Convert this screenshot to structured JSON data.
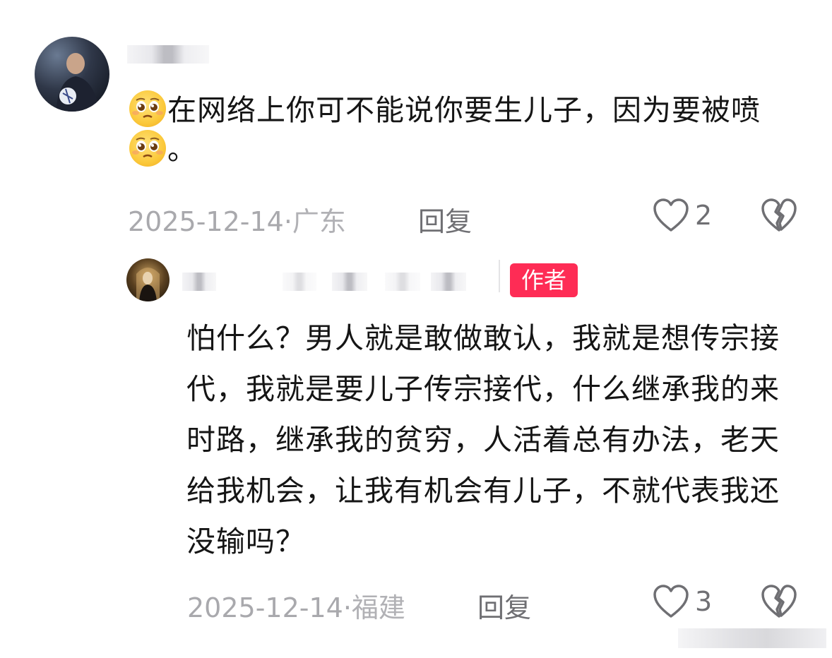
{
  "comment": {
    "text_before_emoji": "在网络上你可不能说你要生儿子，因为要被喷",
    "text_after_emoji": "。",
    "date": "2025-12-14·",
    "location": "广东",
    "reply_label": "回复",
    "likes": "2",
    "emoji_icon": "pleading-face-icon"
  },
  "reply": {
    "author_badge": "作者",
    "text": "怕什么？男人就是敢做敢认，我就是想传宗接代，我就是要儿子传宗接代，什么继承我的来时路，继承我的贫穷，人活着总有办法，老天给我机会，让我有机会有儿子，不就代表我还没输吗？",
    "date": "2025-12-14·",
    "location": "福建",
    "reply_label": "回复",
    "likes": "3"
  },
  "colors": {
    "author_badge_bg": "#fe2c55",
    "meta_text": "#a9a9ad",
    "action_text": "#6f6f73"
  }
}
